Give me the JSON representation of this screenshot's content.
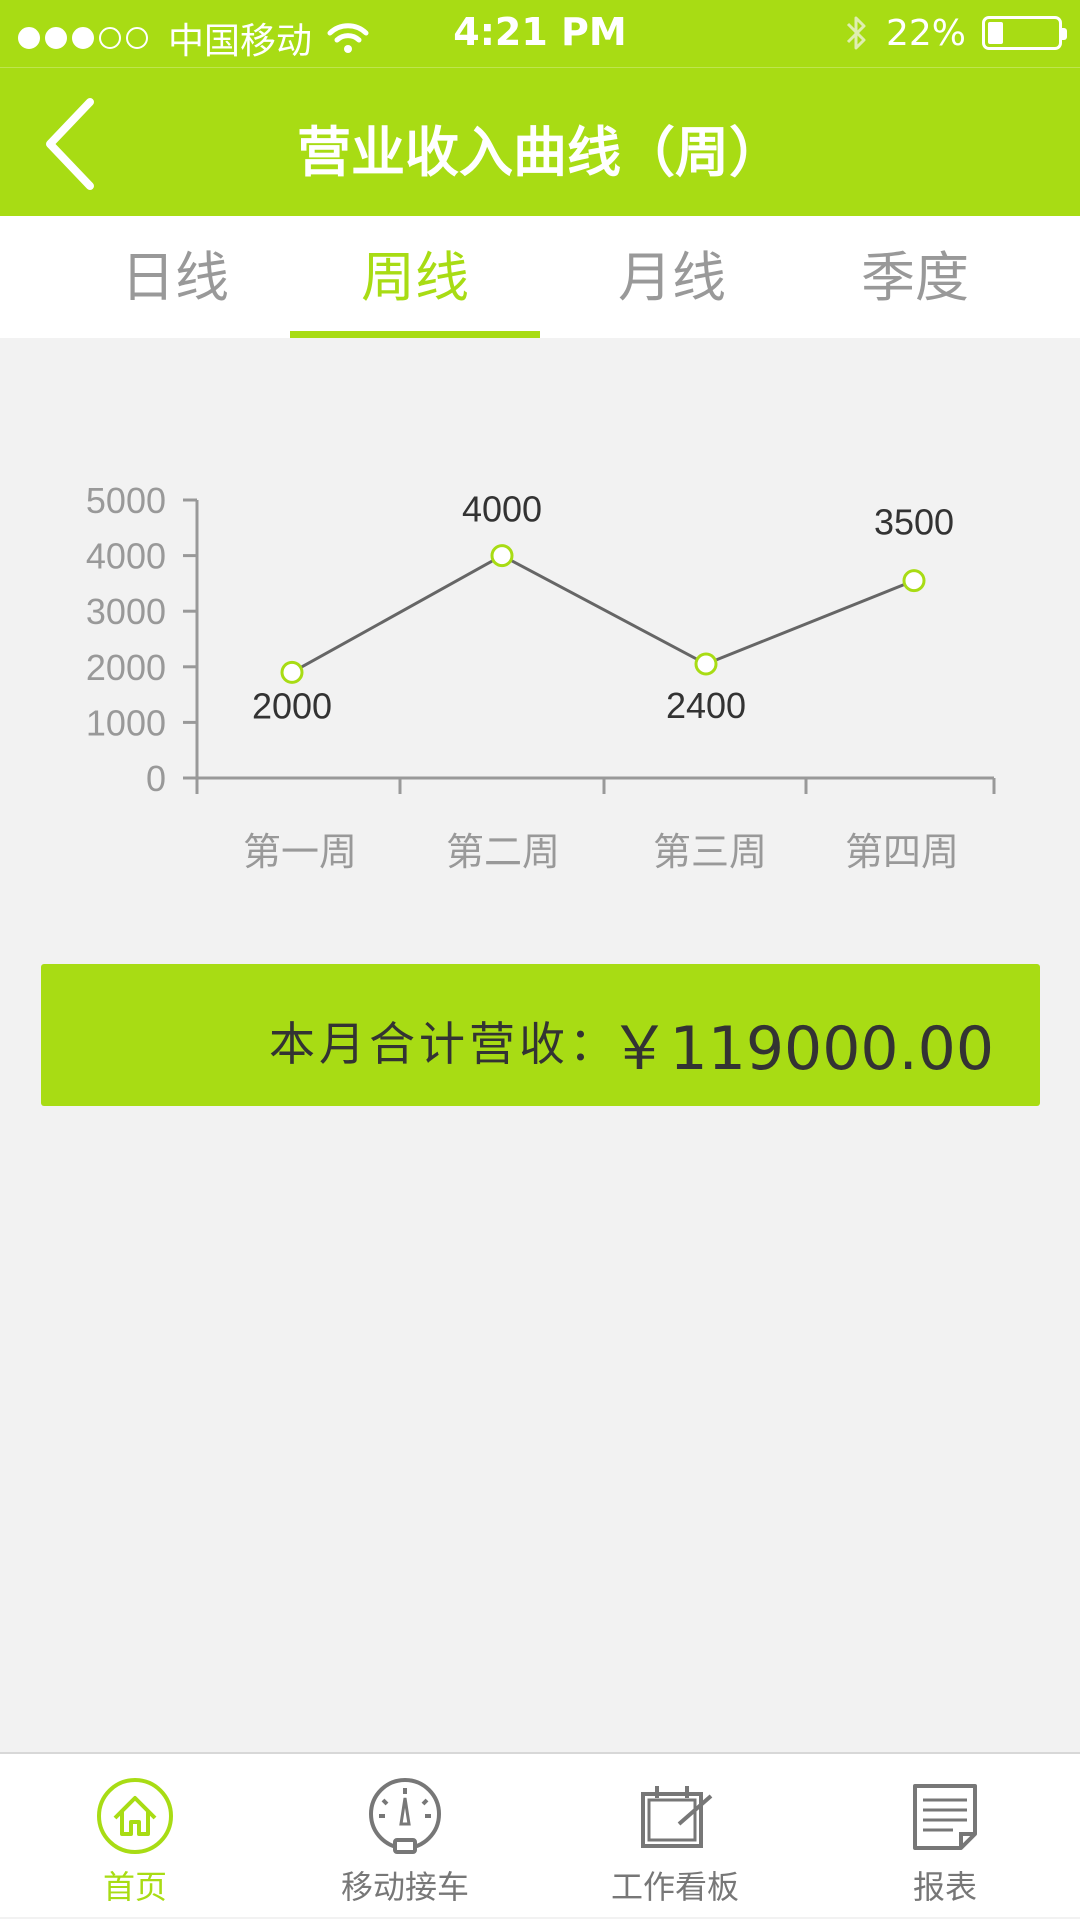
{
  "status_bar": {
    "carrier": "中国移动",
    "time": "4:21 PM",
    "battery": "22%"
  },
  "nav": {
    "title": "营业收入曲线（周）",
    "back_icon": "chevron-left-icon"
  },
  "tabs": [
    {
      "label": "日线",
      "active": false
    },
    {
      "label": "周线",
      "active": true
    },
    {
      "label": "月线",
      "active": false
    },
    {
      "label": "季度",
      "active": false
    }
  ],
  "colors": {
    "accent": "#a8dc14",
    "text_dark": "#333333",
    "text_gray": "#999999",
    "line": "#666666"
  },
  "chart_data": {
    "type": "line",
    "categories": [
      "第一周",
      "第二周",
      "第三周",
      "第四周"
    ],
    "values": [
      1900,
      4000,
      2050,
      3550
    ],
    "data_labels": [
      "2000",
      "4000",
      "2400",
      "3500"
    ],
    "y_ticks": [
      "0",
      "1000",
      "2000",
      "3000",
      "4000",
      "5000"
    ],
    "ylim": [
      0,
      5000
    ],
    "grid": false
  },
  "summary": {
    "label": "本月合计营收：",
    "value": "￥119000.00"
  },
  "tabbar": [
    {
      "label": "首页",
      "icon": "home-icon",
      "active": true
    },
    {
      "label": "移动接车",
      "icon": "gauge-icon",
      "active": false
    },
    {
      "label": "工作看板",
      "icon": "board-icon",
      "active": false
    },
    {
      "label": "报表",
      "icon": "report-icon",
      "active": false
    }
  ]
}
